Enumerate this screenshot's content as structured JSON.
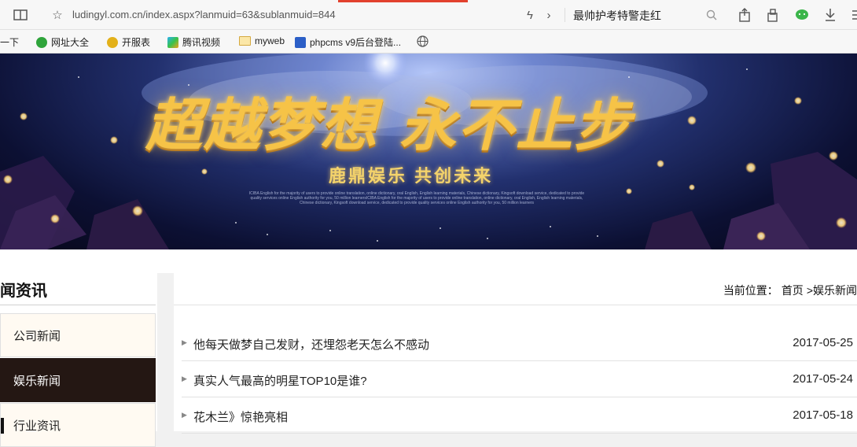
{
  "browser": {
    "url": "ludingyl.com.cn/index.aspx?lanmuid=63&sublanmuid=844",
    "search_query": "最帅护考特警走红",
    "icons": [
      "reader-mode-icon",
      "star-icon",
      "lightning-icon",
      "chevron-right-icon",
      "search-icon",
      "extension-icon",
      "share-icon",
      "wechat-icon",
      "download-icon",
      "menu-icon"
    ]
  },
  "bookmarks": [
    {
      "label": "一下"
    },
    {
      "label": "网址大全"
    },
    {
      "label": "开服表"
    },
    {
      "label": "腾讯视频"
    },
    {
      "label": "myweb"
    },
    {
      "label": "phpcms v9后台登陆..."
    }
  ],
  "banner": {
    "headline": "超越梦想  永不止步",
    "subline": "鹿鼎娱乐  共创未来",
    "fine_print": "ICIBA English for the majority of users to provide online translation, online dictionary, oral English, English learning materials, Chinese dictionary, Kingsoft download service, dedicated to provide quality services online English authority for you, 50 million learnersICIBA English for the majority of users to provide online translation, online dictionary, oral English, English learning materials, Chinese dictionary, Kingsoft download service, dedicated to provide quality services online English authority for you, 50 million learners"
  },
  "sidebar": {
    "title": "闻资讯",
    "items": [
      {
        "label": "公司新闻"
      },
      {
        "label": "娱乐新闻"
      },
      {
        "label": "行业资讯"
      }
    ]
  },
  "breadcrumb": {
    "prefix": "当前位置：",
    "home": "首页",
    "current": ">娱乐新闻"
  },
  "news": [
    {
      "title": "他每天做梦自己发财，还埋怨老天怎么不感动",
      "date": "2017-05-25"
    },
    {
      "title": "真实人气最高的明星TOP10是谁?",
      "date": "2017-05-24"
    },
    {
      "title": "花木兰》惊艳亮相",
      "date": "2017-05-18"
    }
  ],
  "colors": {
    "accent_tab": "#e2412e",
    "active_sidebar_bg": "#241713",
    "banner_gold": "#f6c347"
  }
}
